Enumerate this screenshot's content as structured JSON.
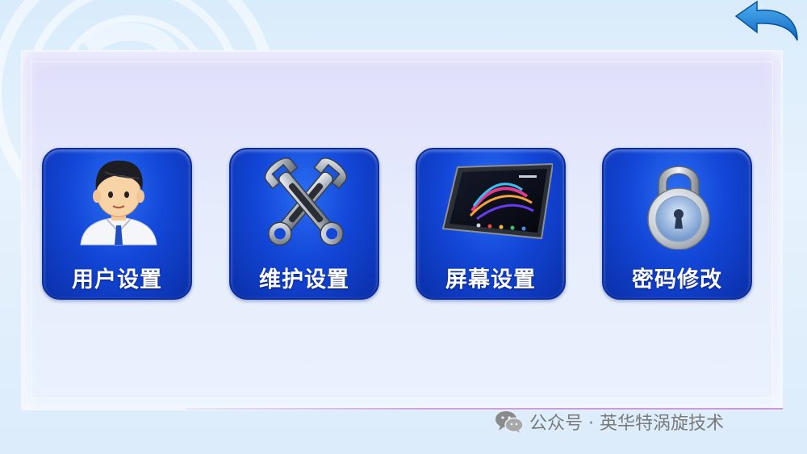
{
  "back_button": {
    "icon": "back-arrow-icon",
    "color": "#1b7fd6"
  },
  "menu": {
    "tiles": [
      {
        "label": "用户设置",
        "icon": "user-icon"
      },
      {
        "label": "维护设置",
        "icon": "wrench-icon"
      },
      {
        "label": "屏幕设置",
        "icon": "tablet-icon"
      },
      {
        "label": "密码修改",
        "icon": "padlock-icon"
      }
    ]
  },
  "watermark": {
    "text": "公众号 · 英华特涡旋技术",
    "icon": "wechat-icon"
  },
  "colors": {
    "tile_blue": "#1347d8",
    "panel_bg": "#e3e6fb",
    "accent_line": "#cf9df0"
  }
}
